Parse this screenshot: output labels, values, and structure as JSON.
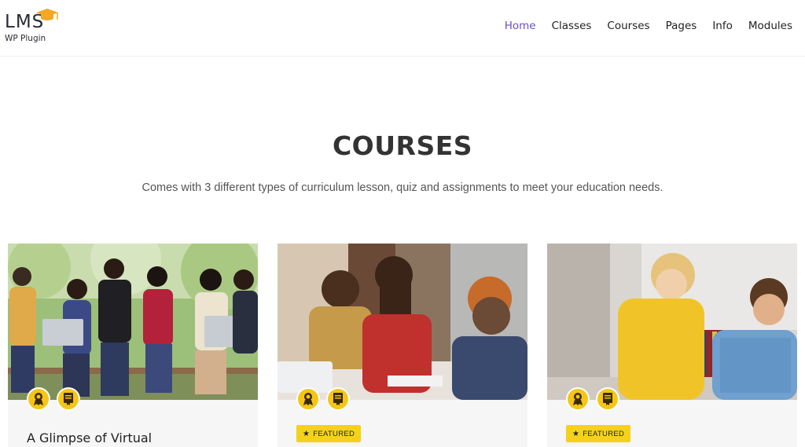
{
  "brand": {
    "logo_text": "LMS",
    "tagline": "WP Plugin"
  },
  "nav": {
    "items": [
      {
        "label": "Home",
        "active": true
      },
      {
        "label": "Classes",
        "active": false
      },
      {
        "label": "Courses",
        "active": false
      },
      {
        "label": "Pages",
        "active": false
      },
      {
        "label": "Info",
        "active": false
      },
      {
        "label": "Modules",
        "active": false
      }
    ]
  },
  "section": {
    "title": "COURSES",
    "subtitle": "Comes with 3 different types of curriculum lesson, quiz and assignments to meet your education needs."
  },
  "cards": [
    {
      "title": "A Glimpse of Virtual",
      "featured_label": "",
      "badges": [
        "award-icon",
        "certificate-icon"
      ]
    },
    {
      "title": "",
      "featured_label": "FEATURED",
      "badges": [
        "award-icon",
        "certificate-icon"
      ]
    },
    {
      "title": "",
      "featured_label": "FEATURED",
      "badges": [
        "award-icon",
        "certificate-icon"
      ]
    }
  ],
  "colors": {
    "accent": "#6a4fc8",
    "badge": "#f5c518",
    "featured": "#f5d21a",
    "text": "#333333"
  }
}
